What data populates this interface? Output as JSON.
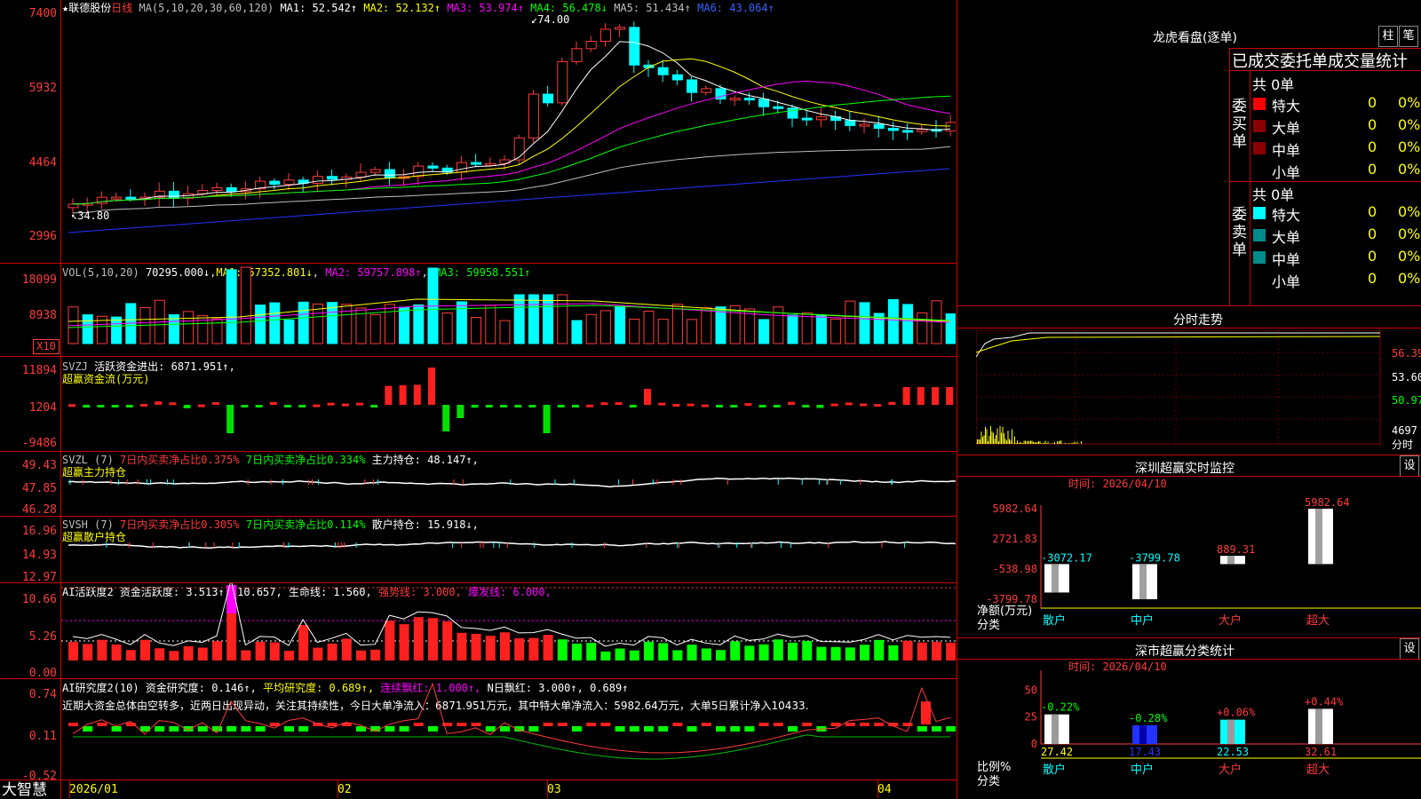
{
  "header": {
    "stock_name": "★联德股份",
    "period": "日线",
    "ma_label": "MA(5,10,20,30,60,120)",
    "ma1": "MA1: 52.542↑",
    "ma2": "MA2: 52.132↑",
    "ma3": "MA3: 53.974↑",
    "ma4": "MA4: 56.478↓",
    "ma5": "MA5: 51.434↑",
    "ma6": "MA6: 43.064↑",
    "high_note": "74.00",
    "low_note": "34.80"
  },
  "price_axis": [
    "7400",
    "5932",
    "4464",
    "2996"
  ],
  "vol": {
    "label": "VOL(5,10,20)",
    "value": "70295.000↓",
    "ma1": "MA1: 57352.801↓",
    "ma2": "MA2: 59757.898↑",
    "ma3": "MA3: 59958.551↑",
    "axis": [
      "18099",
      "8938"
    ],
    "unit": "X10"
  },
  "svzj": {
    "label": "SVZJ",
    "text": "活跃资金进出: 6871.951↑,",
    "sub": "超赢资金流(万元)",
    "axis": [
      "11894",
      "1204",
      "-9486"
    ]
  },
  "svzl": {
    "label": "SVZL (7)",
    "t1": "7日内买卖净占比0.375%",
    "t2": "7日内买卖净占比0.334%",
    "t3": "主力持仓: 48.147↑,",
    "sub": "超赢主力持仓",
    "axis": [
      "49.43",
      "47.85",
      "46.28"
    ]
  },
  "svsh": {
    "label": "SVSH (7)",
    "t1": "7日内买卖净占比0.305%",
    "t2": "7日内买卖净占比0.114%",
    "t3": "散户持仓: 15.918↓,",
    "sub": "超赢散户持仓",
    "axis": [
      "16.96",
      "14.93",
      "12.97"
    ]
  },
  "ai1": {
    "label": "AI活跃度2 资金活跃度: 3.513↑, 10.657, 生命线: 1.560,",
    "strong": "强势线: 3.000,",
    "burst": "爆发线: 6.000,",
    "axis": [
      "10.66",
      "5.26",
      "0.00"
    ]
  },
  "ai2": {
    "label": "AI研究度2(10) 资金研究度: 0.146↑,",
    "avg": "平均研究度: 0.689↑,",
    "cont": "连续飘红: 1.000↑,",
    "n": "N日飘红: 3.000↑, 0.689↑",
    "summary": "近期大资金总体由空转多，近两日出现异动，关注其持续性，今日大单净流入：6871.951万元，其中特大单净流入：5982.64万元，大单5日累计净入10433.",
    "axis": [
      "0.74",
      "0.11",
      "-0.52"
    ]
  },
  "date_axis": [
    "2026/01",
    "02",
    "03",
    "04"
  ],
  "brand": "大智慧",
  "dragon": {
    "title": "龙虎看盘(逐单)",
    "btn1": "柱",
    "btn2": "笔",
    "header": "已成交委托单成交量统计",
    "buy_label": "委买单",
    "sell_label": "委卖单",
    "buy_total": "共 0单",
    "sell_total": "共 0单",
    "rows": [
      "特大",
      "大单",
      "中单",
      "小单"
    ],
    "zero": "0",
    "pct": "0%",
    "buy_colors": [
      "#ff0000",
      "#8b0000",
      "#8b0000",
      "#000000"
    ],
    "sell_colors": [
      "#00ffff",
      "#008b8b",
      "#008b8b",
      "#000000"
    ]
  },
  "fenshi": {
    "title": "分时走势",
    "axis": [
      "56.39",
      "53.60",
      "50.97"
    ],
    "vol": "4697",
    "unit": "分时"
  },
  "sz_monitor": {
    "title": "深圳超赢实时监控",
    "btn": "设",
    "time": "时间: 2026/04/10",
    "axis": [
      "5982.64",
      "2721.83",
      "-538.98",
      "-3799.78"
    ],
    "ylabel": "净额(万元)",
    "xlabel": "分类",
    "categories": [
      "散户",
      "中户",
      "大户",
      "超大"
    ],
    "values": [
      "-3072.17",
      "-3799.78",
      "889.31",
      "5982.64"
    ]
  },
  "sz_class": {
    "title": "深市超赢分类统计",
    "btn": "设",
    "time": "时间: 2026/04/10",
    "axis": [
      "75",
      "50",
      "25",
      "0"
    ],
    "ylabel": "比例%",
    "xlabel": "分类",
    "categories": [
      "散户",
      "中户",
      "大户",
      "超大"
    ],
    "values": [
      "27.42",
      "17.43",
      "22.53",
      "32.61"
    ],
    "changes": [
      "-0.22%",
      "-0.28%",
      "+0.06%",
      "+0.44%"
    ]
  },
  "chart_data": [
    {
      "type": "bar",
      "title": "深圳超赢实时监控",
      "ylabel": "净额(万元)",
      "xlabel": "分类",
      "categories": [
        "散户",
        "中户",
        "大户",
        "超大"
      ],
      "values": [
        -3072.17,
        -3799.78,
        889.31,
        5982.64
      ],
      "ylim": [
        -3799.78,
        5982.64
      ]
    },
    {
      "type": "bar",
      "title": "深市超赢分类统计",
      "ylabel": "比例%",
      "xlabel": "分类",
      "categories": [
        "散户",
        "中户",
        "大户",
        "超大"
      ],
      "values": [
        27.42,
        17.43,
        22.53,
        32.61
      ],
      "ylim": [
        0,
        75
      ]
    }
  ]
}
